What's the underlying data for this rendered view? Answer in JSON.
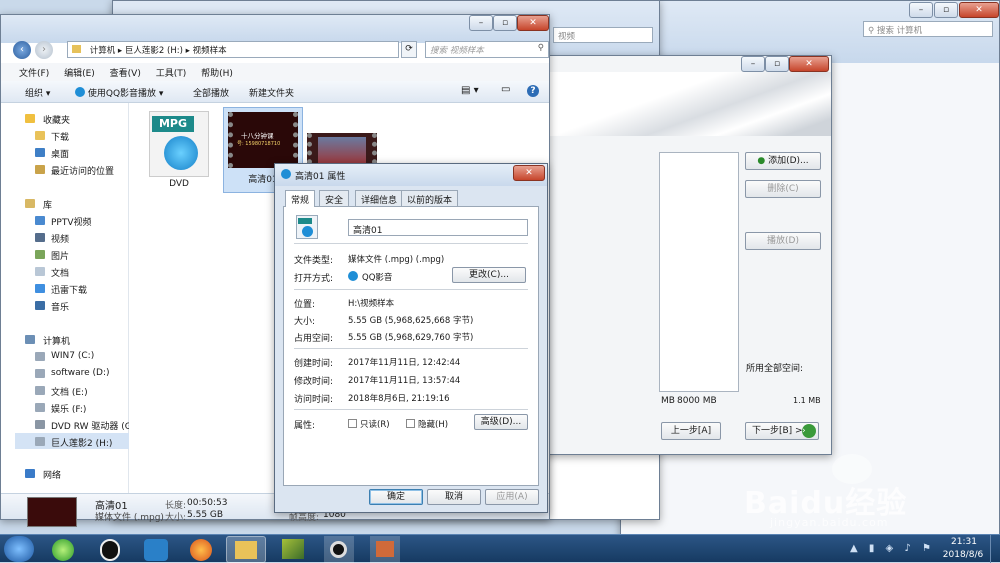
{
  "background_window": {
    "search_placeholder": "搜索 计算机"
  },
  "mid_window": {
    "search_placeholder": "视频"
  },
  "installer": {
    "add_label": "添加(D)...",
    "remove_label": "删除(C)",
    "play_label": "播放(D)",
    "space_label": "所用全部空间:",
    "scale_left": "MB",
    "scale_mid": "8000 MB",
    "scale_right": "1.1 MB",
    "prev_label": "上一步[A]",
    "next_label": "下一步[B] >"
  },
  "explorer": {
    "address": [
      "计算机",
      "巨人莲影2 (H:)",
      "视频样本"
    ],
    "search_placeholder": "搜索 视频样本",
    "menu": [
      "文件(F)",
      "编辑(E)",
      "查看(V)",
      "工具(T)",
      "帮助(H)"
    ],
    "toolbar": {
      "organize": "组织",
      "play_with": "使用QQ影音播放",
      "play_all": "全部播放",
      "new_folder": "新建文件夹"
    },
    "nav": {
      "favorites": "收藏夹",
      "favorites_items": [
        "下载",
        "桌面",
        "最近访问的位置"
      ],
      "library": "库",
      "library_items": [
        "PPTV视频",
        "视频",
        "图片",
        "文档",
        "迅雷下载",
        "音乐"
      ],
      "computer": "计算机",
      "drives": [
        "WIN7 (C:)",
        "software (D:)",
        "文档 (E:)",
        "娱乐 (F:)",
        "DVD RW 驱动器 (G",
        "巨人莲影2 (H:)"
      ],
      "network": "网络"
    },
    "files": [
      {
        "name": "DVD",
        "badge": "MPG"
      },
      {
        "name": "高清01",
        "thumb_text": "十八分钟课",
        "thumb_sub": "号: 15980718710"
      },
      {
        "name": ""
      }
    ],
    "details": {
      "name": "高清01",
      "type": "媒体文件 (.mpg)",
      "duration_label": "长度:",
      "duration": "00:50:53",
      "size_label": "大小:",
      "size": "5.55 GB",
      "height_label": "帧高度:",
      "height": "1080"
    }
  },
  "properties": {
    "title": "高清01 属性",
    "tabs": [
      "常规",
      "安全",
      "详细信息",
      "以前的版本"
    ],
    "filename": "高清01",
    "rows": {
      "type_label": "文件类型:",
      "type": "媒体文件 (.mpg) (.mpg)",
      "open_label": "打开方式:",
      "open_app": "QQ影音",
      "change_label": "更改(C)...",
      "location_label": "位置:",
      "location": "H:\\视频样本",
      "size_label": "大小:",
      "size": "5.55 GB (5,968,625,668 字节)",
      "disk_label": "占用空间:",
      "disk": "5.55 GB (5,968,629,760 字节)",
      "created_label": "创建时间:",
      "created": "2017年11月11日, 12:42:44",
      "modified_label": "修改时间:",
      "modified": "2017年11月11日, 13:57:44",
      "accessed_label": "访问时间:",
      "accessed": "2018年8月6日, 21:19:16",
      "attr_label": "属性:",
      "readonly": "只读(R)",
      "hidden": "隐藏(H)",
      "advanced": "高级(D)..."
    },
    "ok": "确定",
    "cancel": "取消",
    "apply": "应用(A)"
  },
  "taskbar": {
    "time": "21:31",
    "date": "2018/8/6"
  },
  "watermark": {
    "brand": "Baidu经验",
    "url": "jingyan.baidu.com"
  },
  "colors": {
    "accent": "#2d6cb5",
    "taskbar": "#1c3f68"
  }
}
